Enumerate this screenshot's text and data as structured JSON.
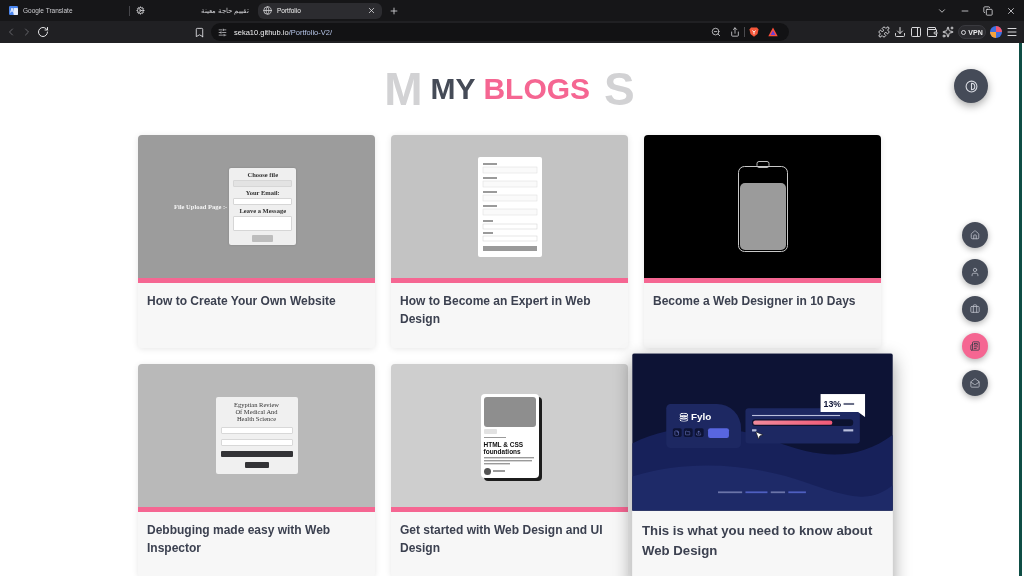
{
  "browser": {
    "tabs": [
      {
        "kind": "translate",
        "title": "Google Translate",
        "selected": false
      },
      {
        "kind": "gear",
        "title": "تقييم حاجة معينة",
        "selected": false
      },
      {
        "kind": "globe",
        "title": "Portfolio",
        "selected": true
      }
    ],
    "nav_buttons": [
      {
        "kind": "back",
        "disabled": true
      },
      {
        "kind": "forward",
        "disabled": true
      },
      {
        "kind": "reload",
        "disabled": false
      }
    ],
    "address": {
      "host": "seka10.github.io",
      "path": "/Portfolio-V2/"
    },
    "vpn_label": "VPN"
  },
  "heading": {
    "backdrop_left": "M",
    "plain": "MY",
    "accent": "BLOGS",
    "backdrop_right": "S"
  },
  "side_nav": [
    {
      "kind": "home",
      "selected": false
    },
    {
      "kind": "about",
      "selected": false
    },
    {
      "kind": "portfolio",
      "selected": false
    },
    {
      "kind": "blogs",
      "selected": true
    },
    {
      "kind": "contact",
      "selected": false
    }
  ],
  "blogs": [
    {
      "title": "How to Create Your Own Website",
      "hovered": false,
      "thumbnail": {
        "kind": "upload_form",
        "heading": "File Upload Page :-",
        "fields": [
          {
            "kind": "file",
            "label": "Choose file"
          },
          {
            "kind": "input",
            "label": "Your Email:"
          },
          {
            "kind": "textarea",
            "label": "Leave a Message"
          }
        ]
      }
    },
    {
      "title": "How to Become an Expert in Web Design",
      "hovered": false,
      "thumbnail": {
        "kind": "signup_form"
      }
    },
    {
      "title": "Become a Web Designer in 10 Days",
      "hovered": false,
      "thumbnail": {
        "kind": "battery"
      }
    },
    {
      "title": "Debbuging made easy with Web Inspector",
      "hovered": false,
      "thumbnail": {
        "kind": "login_form",
        "title": "Egyptian Review Of Medical And Health Science"
      }
    },
    {
      "title": "Get started with Web Design and UI Design",
      "hovered": false,
      "thumbnail": {
        "kind": "profile_card",
        "title": "HTML & CSS foundations"
      }
    },
    {
      "title": "This is what you need to know about Web Design",
      "hovered": true,
      "thumbnail": {
        "kind": "fylo",
        "logo": "Fylo",
        "percent": "13%",
        "level": 0.8
      }
    }
  ]
}
